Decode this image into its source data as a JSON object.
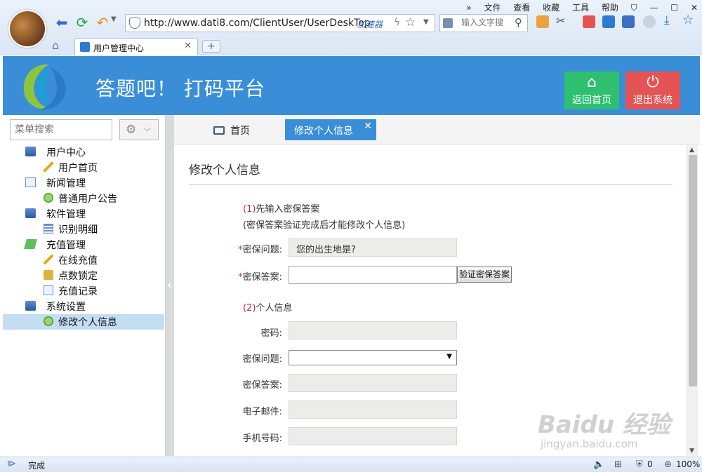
{
  "browser": {
    "url": "http://www.dati8.com/ClientUser/UserDeskTop",
    "accelerator_label": "加速器",
    "search_placeholder": "输入文字搜",
    "tab_title": "用户管理中心",
    "menu": [
      "»",
      "文件",
      "查看",
      "收藏",
      "工具",
      "帮助"
    ],
    "icons": [
      "back-arrow-icon",
      "refresh-icon",
      "undo-icon",
      "shield-icon",
      "bolt-icon",
      "star-icon",
      "search-icon",
      "home-icon"
    ]
  },
  "header": {
    "title": "答题吧！ 打码平台",
    "home_button": "返回首页",
    "logout_button": "退出系统",
    "colors": {
      "header_bg": "#3a8ed8",
      "home_btn": "#2fbf71",
      "logout_btn": "#e55454"
    }
  },
  "sidebar": {
    "search_placeholder": "菜单搜索",
    "items": [
      {
        "label": "用户中心",
        "level": "group",
        "icon": "computer-icon"
      },
      {
        "label": "用户首页",
        "level": "child",
        "icon": "pencil-icon"
      },
      {
        "label": "新闻管理",
        "level": "group",
        "icon": "document-icon"
      },
      {
        "label": "普通用户公告",
        "level": "child",
        "icon": "check-icon"
      },
      {
        "label": "软件管理",
        "level": "group",
        "icon": "computer-icon"
      },
      {
        "label": "识别明细",
        "level": "child",
        "icon": "list-icon"
      },
      {
        "label": "充值管理",
        "level": "group",
        "icon": "money-icon"
      },
      {
        "label": "在线充值",
        "level": "child",
        "icon": "pencil-icon"
      },
      {
        "label": "点数锁定",
        "level": "child",
        "icon": "lock-icon"
      },
      {
        "label": "充值记录",
        "level": "child",
        "icon": "document-icon"
      },
      {
        "label": "系统设置",
        "level": "group",
        "icon": "computer-icon"
      },
      {
        "label": "修改个人信息",
        "level": "child",
        "icon": "check-icon",
        "selected": true
      }
    ]
  },
  "content_tabs": {
    "home": "首页",
    "active": "修改个人信息",
    "close": "✕"
  },
  "form": {
    "page_title": "修改个人信息",
    "section1_num": "(1)",
    "section1_title": "先输入密保答案",
    "section1_note": "(密保答案验证完成后才能修改个人信息)",
    "required_mark": "*",
    "question_label": "密保问题:",
    "question_value": "您的出生地是?",
    "answer_label": "密保答案:",
    "answer_value": "",
    "verify_button": "验证密保答案",
    "section2_num": "(2)",
    "section2_title": "个人信息",
    "password_label": "密码:",
    "question2_label": "密保问题:",
    "answer2_label": "密保答案:",
    "email_label": "电子邮件:",
    "phone_label": "手机号码:"
  },
  "statusbar": {
    "status": "完成",
    "counter": "0",
    "zoom": "100%"
  },
  "watermark": {
    "logo": "Baidu 经验",
    "sub": "jingyan.baidu.com"
  }
}
